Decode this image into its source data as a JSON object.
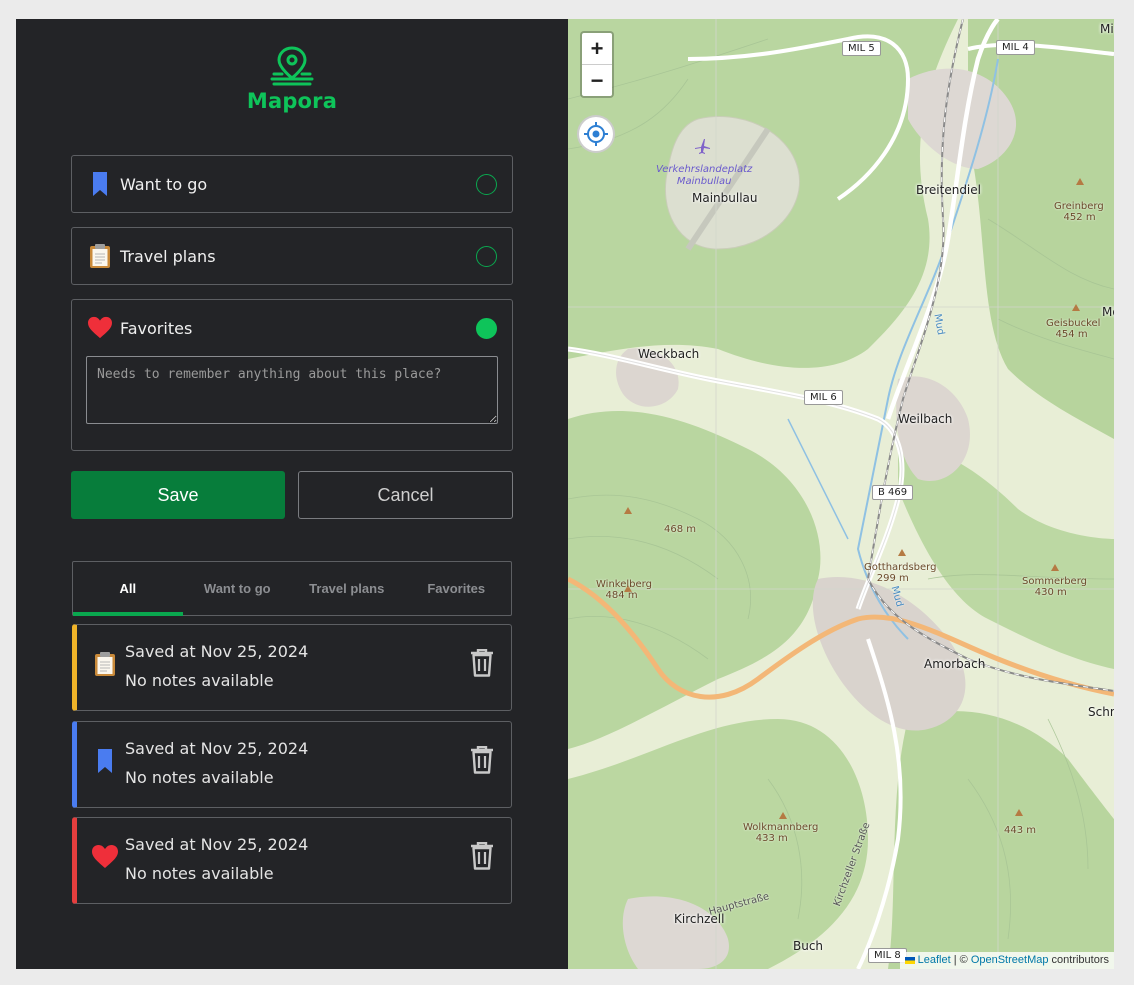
{
  "app": {
    "name": "Mapora",
    "brand_color": "#0ec45a"
  },
  "options": [
    {
      "label": "Want to go",
      "icon": "bookmark-icon",
      "selected": false
    },
    {
      "label": "Travel plans",
      "icon": "clipboard-icon",
      "selected": false
    },
    {
      "label": "Favorites",
      "icon": "heart-icon",
      "selected": true
    }
  ],
  "notes": {
    "placeholder": "Needs to remember anything about this place?"
  },
  "actions": {
    "save": "Save",
    "cancel": "Cancel"
  },
  "tabs": [
    {
      "label": "All",
      "active": true
    },
    {
      "label": "Want to go",
      "active": false
    },
    {
      "label": "Travel plans",
      "active": false
    },
    {
      "label": "Favorites",
      "active": false
    }
  ],
  "saved": [
    {
      "date": "Saved at Nov 25, 2024",
      "notes": "No notes available",
      "icon": "clipboard-icon",
      "accent": "#f0b429"
    },
    {
      "date": "Saved at Nov 25, 2024",
      "notes": "No notes available",
      "icon": "bookmark-icon",
      "accent": "#4a7cf0"
    },
    {
      "date": "Saved at Nov 25, 2024",
      "notes": "No notes available",
      "icon": "heart-icon",
      "accent": "#e53e3e"
    }
  ],
  "map": {
    "zoom_in": "+",
    "zoom_out": "−",
    "attribution": {
      "leaflet": "Leaflet",
      "sep": " | © ",
      "osm": "OpenStreetMap",
      "suffix": " contributors"
    },
    "places": [
      "Mainbullau",
      "Breitendiel",
      "Weckbach",
      "Weilbach",
      "Amorbach",
      "Kirchzell",
      "Buch",
      "Schn",
      "Mi",
      "Mo"
    ],
    "peaks": [
      {
        "name": "Greinberg",
        "elev": "452 m"
      },
      {
        "name": "Geisbuckel",
        "elev": "454 m"
      },
      {
        "name": "",
        "elev": "468 m"
      },
      {
        "name": "Winkelberg",
        "elev": "484 m"
      },
      {
        "name": "Gotthardsberg",
        "elev": "299 m"
      },
      {
        "name": "Sommerberg",
        "elev": "430 m"
      },
      {
        "name": "Wolkmannberg",
        "elev": "433 m"
      },
      {
        "name": "",
        "elev": "443 m"
      }
    ],
    "roads": [
      "MIL 5",
      "MIL 4",
      "MIL 6",
      "B 469",
      "MIL 8"
    ],
    "airfield": [
      "Verkehrslandeplatz",
      "Mainbullau"
    ],
    "streams": [
      "Mud",
      "Mud"
    ],
    "streets": [
      "Kirchzeller Straße",
      "Hauptstraße"
    ]
  }
}
